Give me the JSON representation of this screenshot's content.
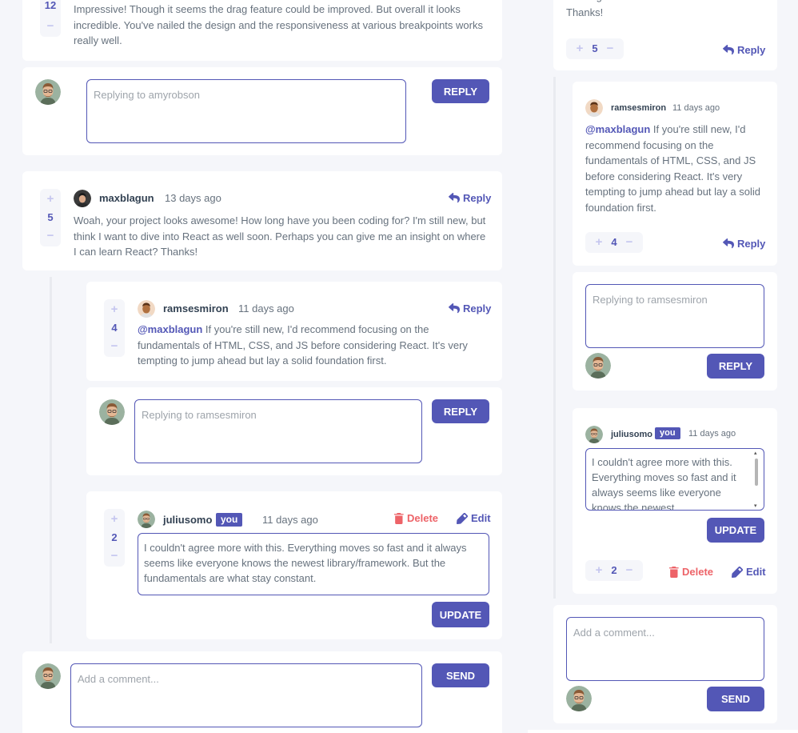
{
  "users": {
    "amyrobson": "amyrobson",
    "maxblagun": "maxblagun",
    "ramsesmiron": "ramsesmiron",
    "juliusomo": "juliusomo"
  },
  "labels": {
    "reply": "Reply",
    "delete": "Delete",
    "edit": "Edit",
    "you": "you",
    "reply_btn": "REPLY",
    "update_btn": "UPDATE",
    "send_btn": "SEND"
  },
  "left": {
    "amy_comment": {
      "score": "12",
      "text": "Impressive! Though it seems the drag feature could be improved. But overall it looks incredible. You've nailed the design and the responsiveness at various breakpoints works really well."
    },
    "reply_to_amy": {
      "placeholder": "Replying to amyrobson"
    },
    "max_comment": {
      "user": "maxblagun",
      "date": "13 days ago",
      "score": "5",
      "text": "Woah, your project looks awesome! How long have you been coding for? I'm still new, but think I want to dive into React as well soon. Perhaps you can give me an insight on where I can learn React? Thanks!"
    },
    "ramses_reply": {
      "user": "ramsesmiron",
      "date": "11 days ago",
      "score": "4",
      "mention": "@maxblagun",
      "text": " If you're still new, I'd recommend focusing on the fundamentals of HTML, CSS, and JS before considering React. It's very tempting to jump ahead but lay a solid foundation first."
    },
    "reply_to_ramses": {
      "placeholder": "Replying to ramsesmiron"
    },
    "julius_reply": {
      "user": "juliusomo",
      "date": "11 days ago",
      "score": "2",
      "text": "I couldn't agree more with this. Everything moves so fast and it always seems like everyone knows the newest library/framework. But the fundamentals are what stay constant."
    },
    "add_comment": {
      "placeholder": "Add a comment..."
    }
  },
  "right": {
    "max_tail": {
      "text": "Thanks!",
      "score": "5"
    },
    "ramses_reply": {
      "user": "ramsesmiron",
      "date": "11 days ago",
      "score": "4",
      "mention": "@maxblagun",
      "text": " If you're still new, I'd recommend focusing on the fundamentals of HTML, CSS, and JS before considering React. It's very tempting to jump ahead but lay a solid foundation first."
    },
    "reply_to_ramses": {
      "placeholder": "Replying to ramsesmiron"
    },
    "julius_reply": {
      "user": "juliusomo",
      "date": "11 days ago",
      "score": "2",
      "text": "I couldn't agree more with this. Everything moves so fast and it always seems like everyone knows the newest library/framework. But the fundamentals are what stay constant."
    },
    "add_comment": {
      "placeholder": "Add a comment..."
    }
  },
  "colors": {
    "accent": "#5357b6",
    "danger": "#ed6368",
    "vote_bg": "#f5f6fa",
    "thread_line": "#e9ebf0"
  }
}
